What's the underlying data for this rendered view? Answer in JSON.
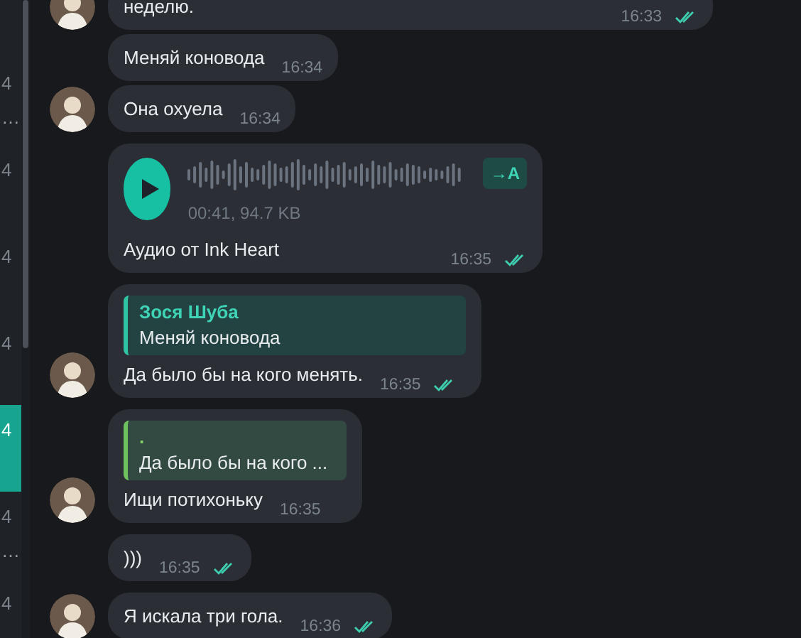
{
  "sidebar": {
    "items": [
      {
        "time": "4",
        "preview": "…",
        "selected": false
      },
      {
        "time": "4",
        "selected": false
      },
      {
        "time": "4",
        "selected": false
      },
      {
        "time": "4",
        "selected": false
      },
      {
        "time": "4",
        "selected": true
      },
      {
        "time": "4",
        "preview": "…",
        "selected": false
      },
      {
        "time": "4",
        "selected": false
      }
    ]
  },
  "messages": [
    {
      "kind": "text",
      "text": "неделю.",
      "time": "16:33",
      "read": true,
      "avatar": true,
      "wide": true
    },
    {
      "kind": "text",
      "text": "Меняй коновода",
      "time": "16:34",
      "read": false,
      "avatar": false
    },
    {
      "kind": "text",
      "text": "Она охуела",
      "time": "16:34",
      "read": false,
      "avatar": true
    },
    {
      "kind": "audio",
      "duration": "00:41, 94.7 KB",
      "transcribe": "→A",
      "caption": "Аудио от Ink Heart",
      "time": "16:35",
      "read": true,
      "avatar": false
    },
    {
      "kind": "reply",
      "quote_author": "Зося Шуба",
      "quote_text": "Меняй коновода",
      "text": "Да было бы на кого менять.",
      "time": "16:35",
      "read": true,
      "avatar": true
    },
    {
      "kind": "reply",
      "quote_author": ".",
      "quote_text": "Да было бы на кого ...",
      "text": "Ищи потихоньку",
      "time": "16:35",
      "read": false,
      "avatar": true
    },
    {
      "kind": "text",
      "text": ")))",
      "time": "16:35",
      "read": true,
      "avatar": false
    },
    {
      "kind": "text",
      "text": "Я искала три гола.",
      "time": "16:36",
      "read": true,
      "avatar": true
    }
  ]
}
